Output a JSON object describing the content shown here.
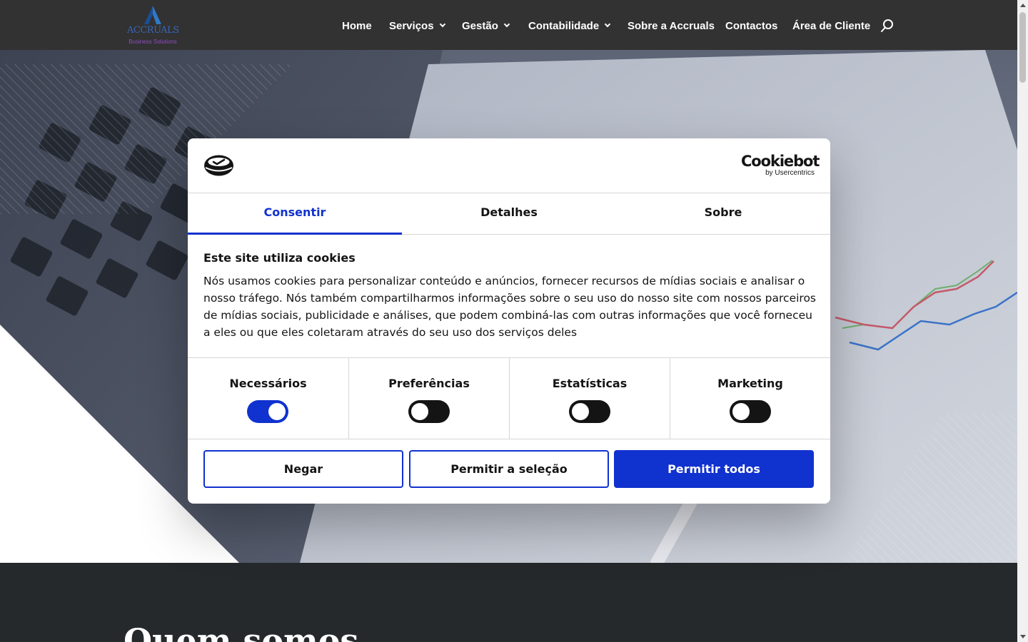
{
  "header": {
    "logo": {
      "wordmark": "ACCRUALS",
      "tagline": "Business Solutions"
    },
    "nav": [
      {
        "label": "Home",
        "has_dropdown": false
      },
      {
        "label": "Serviços",
        "has_dropdown": true
      },
      {
        "label": "Gestão",
        "has_dropdown": true
      },
      {
        "label": "Contabilidade",
        "has_dropdown": true
      },
      {
        "label": "Sobre a Accruals",
        "has_dropdown": false
      },
      {
        "label": "Contactos",
        "has_dropdown": false
      },
      {
        "label": "Área de Cliente",
        "has_dropdown": false
      }
    ],
    "search_icon": "search-icon"
  },
  "section": {
    "title": "Quem somos"
  },
  "cookie_dialog": {
    "brand": {
      "name": "Cookiebot",
      "by": "by Usercentrics"
    },
    "tabs": [
      {
        "label": "Consentir",
        "active": true
      },
      {
        "label": "Detalhes",
        "active": false
      },
      {
        "label": "Sobre",
        "active": false
      }
    ],
    "title": "Este site utiliza cookies",
    "description": "Nós usamos cookies para personalizar conteúdo e anúncios, fornecer recursos de mídias sociais e analisar o nosso tráfego. Nós também compartilharmos informações sobre o seu uso do nosso site com nossos parceiros de mídias sociais, publicidade e análises, que podem combiná-las com outras informações que você forneceu a eles ou que eles coletaram através do seu uso dos serviços deles",
    "categories": [
      {
        "label": "Necessários",
        "enabled": true
      },
      {
        "label": "Preferências",
        "enabled": false
      },
      {
        "label": "Estatísticas",
        "enabled": false
      },
      {
        "label": "Marketing",
        "enabled": false
      }
    ],
    "buttons": {
      "deny": "Negar",
      "allow_selection": "Permitir a seleção",
      "allow_all": "Permitir todos"
    }
  },
  "colors": {
    "header_bg": "#323232",
    "accent": "#1032cf",
    "section_bg": "#25292c",
    "text": "#141414"
  }
}
